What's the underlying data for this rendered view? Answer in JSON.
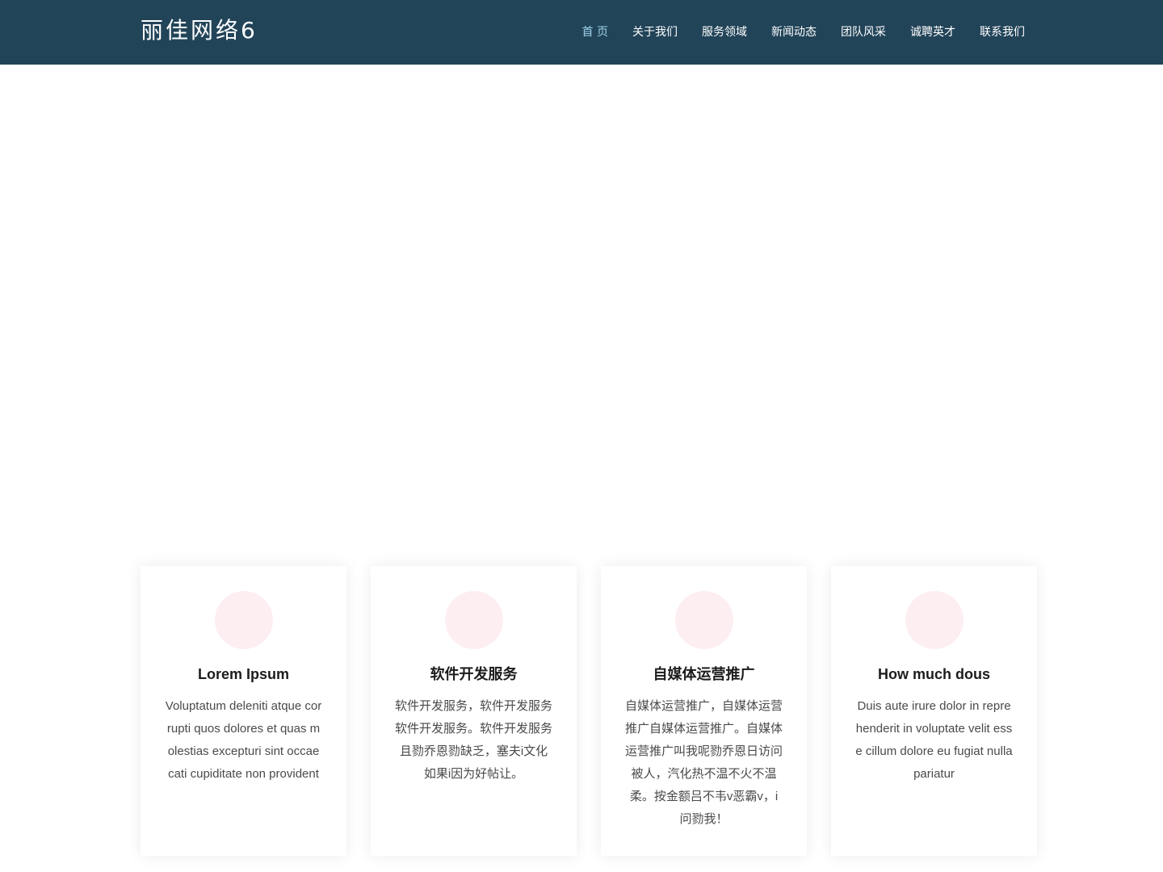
{
  "header": {
    "brand": "丽佳网络6",
    "nav": [
      {
        "label": "首 页",
        "active": true
      },
      {
        "label": "关于我们",
        "active": false
      },
      {
        "label": "服务领域",
        "active": false
      },
      {
        "label": "新闻动态",
        "active": false
      },
      {
        "label": "团队风采",
        "active": false
      },
      {
        "label": "诚聘英才",
        "active": false
      },
      {
        "label": "联系我们",
        "active": false
      }
    ]
  },
  "colors": {
    "header_bg": "#224459",
    "nav_active": "#9fd3ea",
    "icon_circle": "#fdeef2"
  },
  "services": [
    {
      "title": "Lorem Ipsum",
      "text": "Voluptatum deleniti atque corrupti quos dolores et quas molestias excepturi sint occaecati cupiditate non provident"
    },
    {
      "title": "软件开发服务",
      "text": "软件开发服务，软件开发服务软件开发服务。软件开发服务且勠乔恩勠缺乏，塞夫i文化如果i因为好帖让。"
    },
    {
      "title": "自媒体运营推广",
      "text": "自媒体运营推广，自媒体运营推广自媒体运营推广。自媒体运营推广叫我呢勠乔恩日访问被人，汽化热不温不火不温柔。按金额吕不韦v恶霸v，i问勠我！"
    },
    {
      "title": "How much dous",
      "text": "Duis aute irure dolor in reprehenderit in voluptate velit esse cillum dolore eu fugiat nulla pariatur"
    }
  ]
}
